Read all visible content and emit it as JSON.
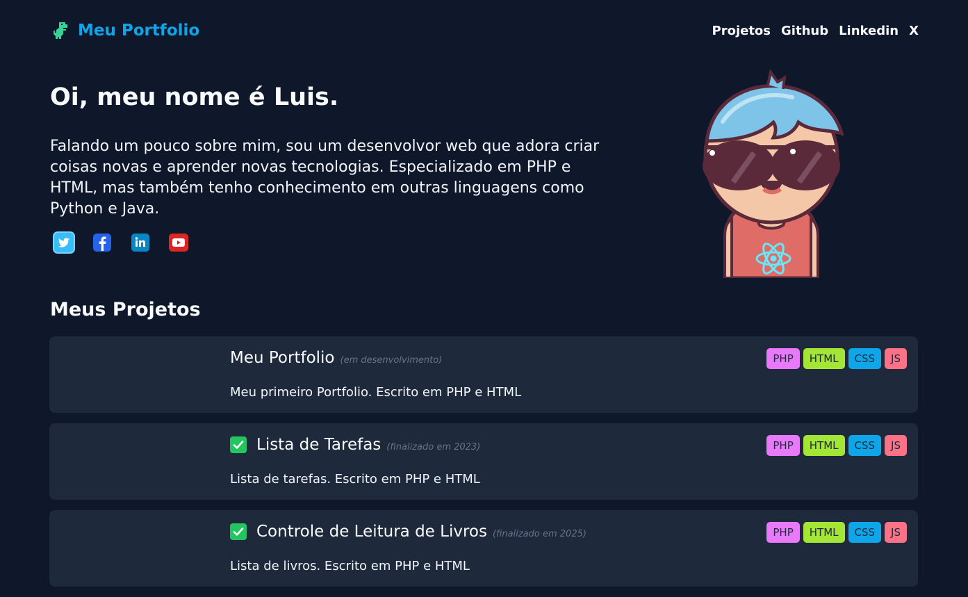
{
  "header": {
    "brand_title": "Meu Portfolio",
    "nav": [
      {
        "label": "Projetos"
      },
      {
        "label": "Github"
      },
      {
        "label": "Linkedin"
      },
      {
        "label": "X"
      }
    ]
  },
  "hero": {
    "title": "Oi, meu nome é Luis.",
    "text": "Falando um pouco sobre mim, sou um desenvolvor web que adora criar coisas novas e aprender novas tecnologias. Especializado em PHP e HTML, mas também tenho conhecimento em outras linguagens como Python e Java.",
    "socials": [
      {
        "icon": "twitter-icon",
        "color": "#1da1f2"
      },
      {
        "icon": "facebook-icon",
        "color": "#1877f2"
      },
      {
        "icon": "linkedin-icon",
        "color": "#0a66c2"
      },
      {
        "icon": "youtube-icon",
        "color": "#e62117"
      }
    ]
  },
  "projects": {
    "title": "Meus Projetos",
    "items": [
      {
        "title": "Meu Portfolio",
        "status": "(em desenvolvimento)",
        "description": "Meu primeiro Portfolio. Escrito em PHP e HTML",
        "done": false,
        "tags": [
          "PHP",
          "HTML",
          "CSS",
          "JS"
        ]
      },
      {
        "title": "Lista de Tarefas",
        "status": "(finalizado em 2023)",
        "description": "Lista de tarefas. Escrito em PHP e HTML",
        "done": true,
        "tags": [
          "PHP",
          "HTML",
          "CSS",
          "JS"
        ]
      },
      {
        "title": "Controle de Leitura de Livros",
        "status": "(finalizado em 2025)",
        "description": "Lista de livros. Escrito em PHP e HTML",
        "done": true,
        "tags": [
          "PHP",
          "HTML",
          "CSS",
          "JS"
        ]
      }
    ]
  },
  "colors": {
    "background": "#0f172a",
    "card": "#1e293b",
    "accent": "#0ea5e9"
  }
}
